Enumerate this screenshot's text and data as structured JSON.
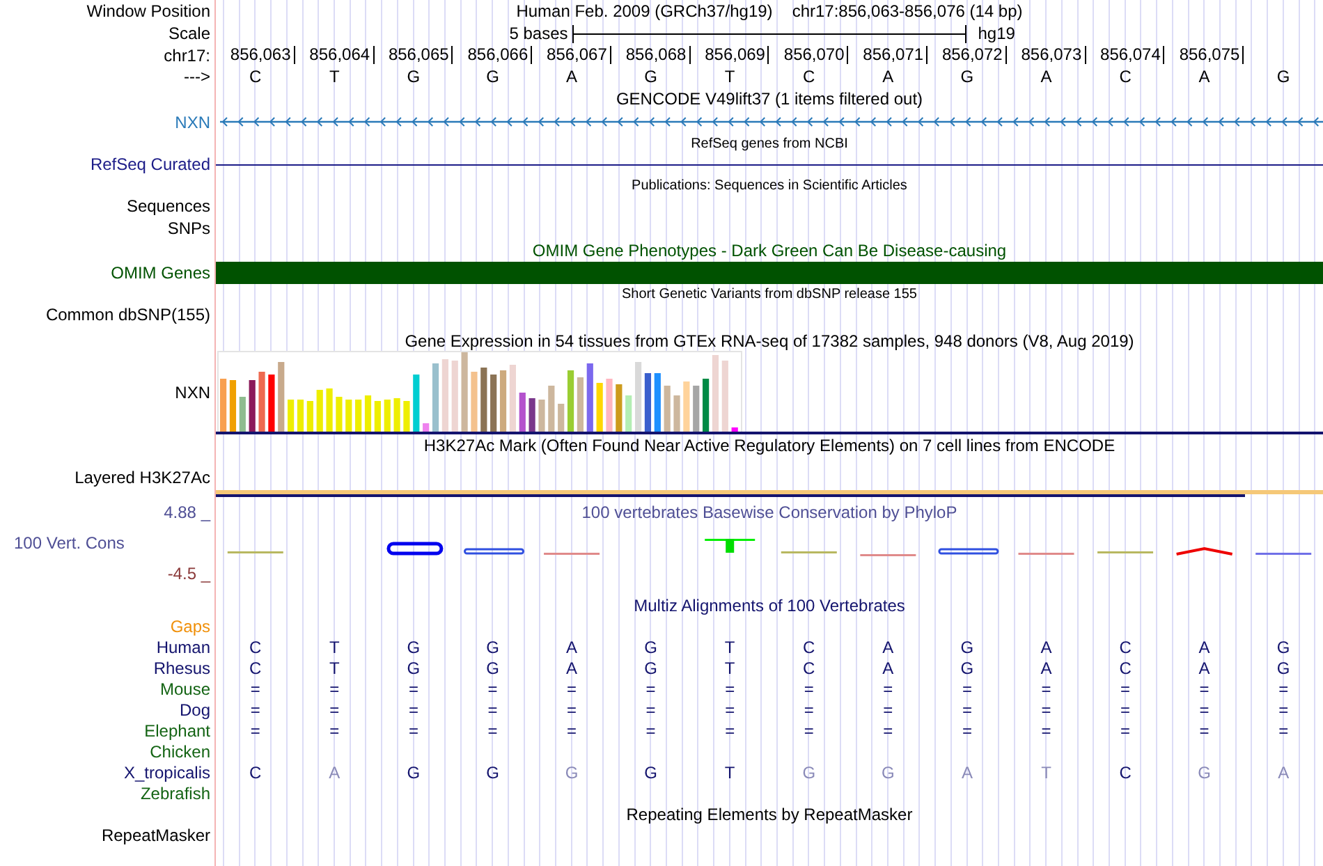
{
  "header": {
    "window_position_label": "Window Position",
    "assembly": "Human Feb. 2009 (GRCh37/hg19)",
    "position": "chr17:856,063-856,076 (14 bp)",
    "scale_label": "Scale",
    "scale_text": "5 bases",
    "scale_assembly": "hg19",
    "chrom_label": "chr17:",
    "strand_label": "--->",
    "positions": [
      "856,063",
      "856,064",
      "856,065",
      "856,066",
      "856,067",
      "856,068",
      "856,069",
      "856,070",
      "856,071",
      "856,072",
      "856,073",
      "856,074",
      "856,075"
    ],
    "bases": [
      "C",
      "T",
      "G",
      "G",
      "A",
      "G",
      "T",
      "C",
      "A",
      "G",
      "A",
      "C",
      "A",
      "G"
    ]
  },
  "tracks": [
    {
      "kind": "gene",
      "title": "GENCODE V49lift37 (1 items filtered out)",
      "label": "NXN",
      "color": "#2a7ab8"
    },
    {
      "kind": "line",
      "title": "RefSeq genes from NCBI",
      "label": "RefSeq Curated",
      "color": "#1c1c88"
    },
    {
      "kind": "empty",
      "title": "Publications: Sequences in Scientific Articles",
      "labels": [
        "Sequences",
        "SNPs"
      ]
    },
    {
      "kind": "bar",
      "title": "OMIM Gene Phenotypes - Dark Green Can Be Disease-causing",
      "label": "OMIM Genes",
      "color": "#005200"
    },
    {
      "kind": "empty",
      "title": "Short Genetic Variants from dbSNP release 155",
      "labels": [
        "Common dbSNP(155)"
      ]
    },
    {
      "kind": "expression",
      "title": "Gene Expression in 54 tissues from GTEx RNA-seq of 17382 samples, 948 donors (V8, Aug 2019)",
      "label": "NXN"
    },
    {
      "kind": "signal",
      "title": "H3K27Ac Mark (Often Found Near Active Regulatory Elements) on 7 cell lines from ENCODE",
      "label": "Layered H3K27Ac"
    },
    {
      "kind": "conservation",
      "title": "100 vertebrates Basewise Conservation by PhyloP",
      "label": "100 Vert. Cons",
      "max": "4.88 _",
      "min": "-4.5 _"
    },
    {
      "kind": "alignment",
      "title": "Multiz Alignments of 100 Vertebrates",
      "gaps_label": "Gaps",
      "species": [
        {
          "name": "Human",
          "color": "#14146e",
          "cells": [
            {
              "base": "C",
              "match": true
            },
            {
              "base": "T",
              "match": true
            },
            {
              "base": "G",
              "match": true
            },
            {
              "base": "G",
              "match": true
            },
            {
              "base": "A",
              "match": true
            },
            {
              "base": "G",
              "match": true
            },
            {
              "base": "T",
              "match": true
            },
            {
              "base": "C",
              "match": true
            },
            {
              "base": "A",
              "match": true
            },
            {
              "base": "G",
              "match": true
            },
            {
              "base": "A",
              "match": true
            },
            {
              "base": "C",
              "match": true
            },
            {
              "base": "A",
              "match": true
            },
            {
              "base": "G",
              "match": true
            }
          ]
        },
        {
          "name": "Rhesus",
          "color": "#14146e",
          "cells": [
            {
              "base": "C",
              "match": true
            },
            {
              "base": "T",
              "match": true
            },
            {
              "base": "G",
              "match": true
            },
            {
              "base": "G",
              "match": true
            },
            {
              "base": "A",
              "match": true
            },
            {
              "base": "G",
              "match": true
            },
            {
              "base": "T",
              "match": true
            },
            {
              "base": "C",
              "match": true
            },
            {
              "base": "A",
              "match": true
            },
            {
              "base": "G",
              "match": true
            },
            {
              "base": "A",
              "match": true
            },
            {
              "base": "C",
              "match": true
            },
            {
              "base": "A",
              "match": true
            },
            {
              "base": "G",
              "match": true
            }
          ]
        },
        {
          "name": "Mouse",
          "color": "#146414",
          "cells": [
            {
              "base": "=",
              "match": true
            },
            {
              "base": "=",
              "match": true
            },
            {
              "base": "=",
              "match": true
            },
            {
              "base": "=",
              "match": true
            },
            {
              "base": "=",
              "match": true
            },
            {
              "base": "=",
              "match": true
            },
            {
              "base": "=",
              "match": true
            },
            {
              "base": "=",
              "match": true
            },
            {
              "base": "=",
              "match": true
            },
            {
              "base": "=",
              "match": true
            },
            {
              "base": "=",
              "match": true
            },
            {
              "base": "=",
              "match": true
            },
            {
              "base": "=",
              "match": true
            },
            {
              "base": "=",
              "match": true
            }
          ]
        },
        {
          "name": "Dog",
          "color": "#14146e",
          "cells": [
            {
              "base": "=",
              "match": true
            },
            {
              "base": "=",
              "match": true
            },
            {
              "base": "=",
              "match": true
            },
            {
              "base": "=",
              "match": true
            },
            {
              "base": "=",
              "match": true
            },
            {
              "base": "=",
              "match": true
            },
            {
              "base": "=",
              "match": true
            },
            {
              "base": "=",
              "match": true
            },
            {
              "base": "=",
              "match": true
            },
            {
              "base": "=",
              "match": true
            },
            {
              "base": "=",
              "match": true
            },
            {
              "base": "=",
              "match": true
            },
            {
              "base": "=",
              "match": true
            },
            {
              "base": "=",
              "match": true
            }
          ]
        },
        {
          "name": "Elephant",
          "color": "#146414",
          "cells": [
            {
              "base": "=",
              "match": true
            },
            {
              "base": "=",
              "match": true
            },
            {
              "base": "=",
              "match": true
            },
            {
              "base": "=",
              "match": true
            },
            {
              "base": "=",
              "match": true
            },
            {
              "base": "=",
              "match": true
            },
            {
              "base": "=",
              "match": true
            },
            {
              "base": "=",
              "match": true
            },
            {
              "base": "=",
              "match": true
            },
            {
              "base": "=",
              "match": true
            },
            {
              "base": "=",
              "match": true
            },
            {
              "base": "=",
              "match": true
            },
            {
              "base": "=",
              "match": true
            },
            {
              "base": "=",
              "match": true
            }
          ]
        },
        {
          "name": "Chicken",
          "color": "#146414"
        },
        {
          "name": "X_tropicalis",
          "color": "#14146e",
          "cells": [
            {
              "base": "C",
              "match": true
            },
            {
              "base": "A",
              "match": false
            },
            {
              "base": "G",
              "match": true
            },
            {
              "base": "G",
              "match": true
            },
            {
              "base": "G",
              "match": false
            },
            {
              "base": "G",
              "match": true
            },
            {
              "base": "T",
              "match": true
            },
            {
              "base": "G",
              "match": false
            },
            {
              "base": "G",
              "match": false
            },
            {
              "base": "A",
              "match": false
            },
            {
              "base": "T",
              "match": false
            },
            {
              "base": "C",
              "match": true
            },
            {
              "base": "G",
              "match": false
            },
            {
              "base": "A",
              "match": false
            }
          ]
        },
        {
          "name": "Zebrafish",
          "color": "#146414"
        }
      ]
    },
    {
      "kind": "repeats",
      "title": "Repeating Elements by RepeatMasker",
      "label": "RepeatMasker"
    }
  ]
}
